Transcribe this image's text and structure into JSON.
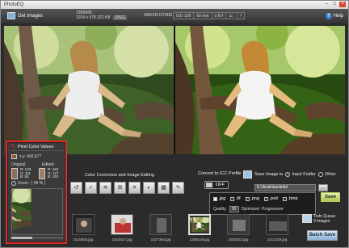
{
  "window": {
    "title": "PhotoEQ",
    "controls": [
      "–",
      "□",
      "×"
    ]
  },
  "toolbar": {
    "get_images": "Get Images",
    "file_name": "1358428",
    "file_dims": "1024 x 678",
    "file_size": "322 KB",
    "file_type": "JPEG",
    "camera": "NIKON D7000",
    "exif": [
      "ISO 100",
      "60 mm",
      "0 EV",
      "1/..",
      "f"
    ],
    "help": "Help",
    "help_icon": "?"
  },
  "editing": {
    "section_label": "Color Correction and Image Editing",
    "tool_icons": [
      "↺",
      "✓",
      "≋",
      "⊞",
      "✕",
      "◐",
      "▦",
      "✎"
    ]
  },
  "icc": {
    "label": "Convert to ICC Profile",
    "toggle": "OFF"
  },
  "save": {
    "label": "Save Image to",
    "option_input": "Input Folder",
    "option_other": "Other",
    "path": "E:\\Arak\\kartinki\\",
    "browse": "...",
    "button": "Save"
  },
  "formats": {
    "items": [
      {
        "ext": ".jpg",
        "checked": true
      },
      {
        "ext": ".tif",
        "checked": false
      },
      {
        "ext": ".png",
        "checked": false
      },
      {
        "ext": ".psd",
        "checked": false
      },
      {
        "ext": ".bmp",
        "checked": false
      }
    ],
    "quality_label": "Quality:",
    "quality_value": "90",
    "optimized": "Optimized",
    "progressive": "Progressive"
  },
  "queue": {
    "title": "Todo Queue",
    "count": "0 images",
    "batch_button": "Batch Save"
  },
  "filmstrip": [
    {
      "name": "1515505.jpg",
      "selected": false
    },
    {
      "name": "1519427.jpg",
      "selected": false
    },
    {
      "name": "1527364.jpg",
      "selected": false
    },
    {
      "name": "1358428.jpg",
      "selected": true
    },
    {
      "name": "1552033.jpg",
      "selected": false
    },
    {
      "name": "1411229.jpg",
      "selected": false
    }
  ],
  "pixel_panel": {
    "title": "Pixel Color Values",
    "xy": "x,y:  492,677",
    "original_label": "Original:",
    "edited_label": "Edited:",
    "original_rgb": [
      "R: 143",
      "G: 111",
      "B: 92"
    ],
    "edited_rgb": [
      "R: 162",
      "G: 127",
      "B: 103"
    ],
    "zoom": "Zoom : [ 49 % ]",
    "original_color": "#8f6f5c",
    "edited_color": "#a27f67"
  },
  "colors": {
    "accent_red": "#e02a2a",
    "save_green": "#a9c44c",
    "batch_blue": "#8cb0d4"
  }
}
